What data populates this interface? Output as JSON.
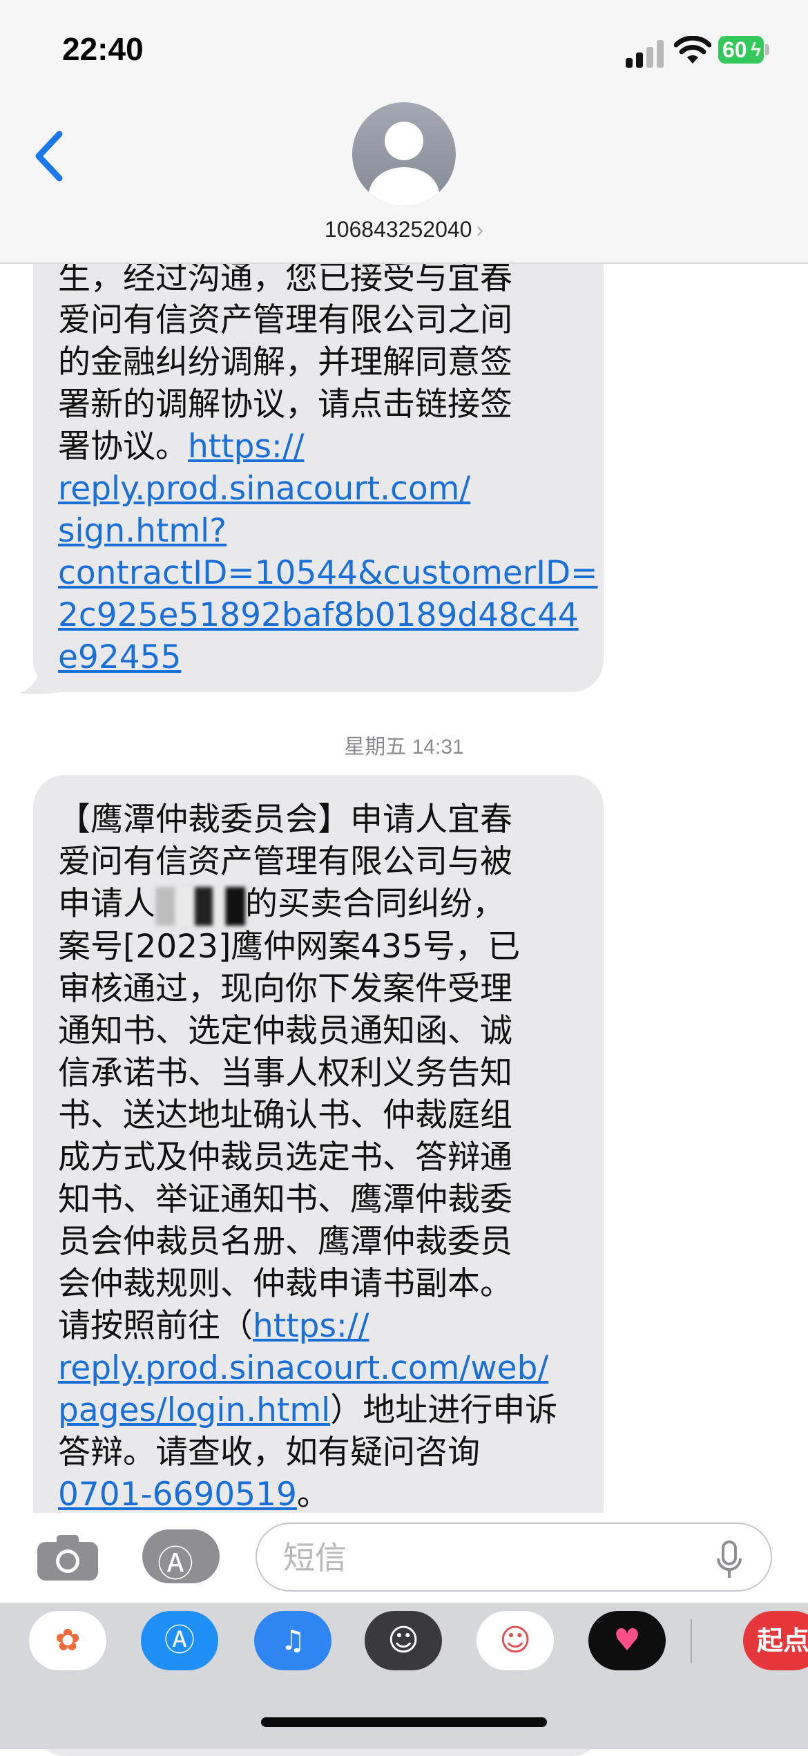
{
  "status_bar": {
    "time": "22:40",
    "battery": "60"
  },
  "header": {
    "contact": "106843252040",
    "chevron": "›"
  },
  "messages": [
    {
      "text": "生，经过沟通，您已接受与宜春\n爱问有信资产管理有限公司之间\n的金融纠纷调解，并理解同意签\n署新的调解协议，请点击链接签\n署协议。",
      "link": "https://\nreply.prod.sinacourt.com/\nsign.html?\ncontractID=10544&customerID=\n2c925e51892baf8b0189d48c44\ne92455"
    }
  ],
  "timestamp": "星期五 14:31",
  "message2": {
    "part1": "【鹰潭仲裁委员会】申请人宜春\n爱问有信资产管理有限公司与被\n申请人",
    "part2": "的买卖合同纠纷，\n案号[2023]鹰仲网案435号，已\n审核通过，现向你下发案件受理\n通知书、选定仲裁员通知函、诚\n信承诺书、当事人权利义务告知\n书、送达地址确认书、仲裁庭组\n成方式及仲裁员选定书、答辩通\n知书、举证通知书、鹰潭仲裁委\n员会仲裁员名册、鹰潭仲裁委员\n会仲裁规则、仲裁申请书副本。\n请按照前往（",
    "link": "https://\nreply.prod.sinacourt.com/web/\npages/login.html",
    "part3": "）地址进行申诉\n答辩。请查收，如有疑问咨询\n",
    "phone": "0701-6690519",
    "part4": "。"
  },
  "input": {
    "placeholder": "短信"
  },
  "app_strip": {
    "last_app_label": "起点"
  }
}
